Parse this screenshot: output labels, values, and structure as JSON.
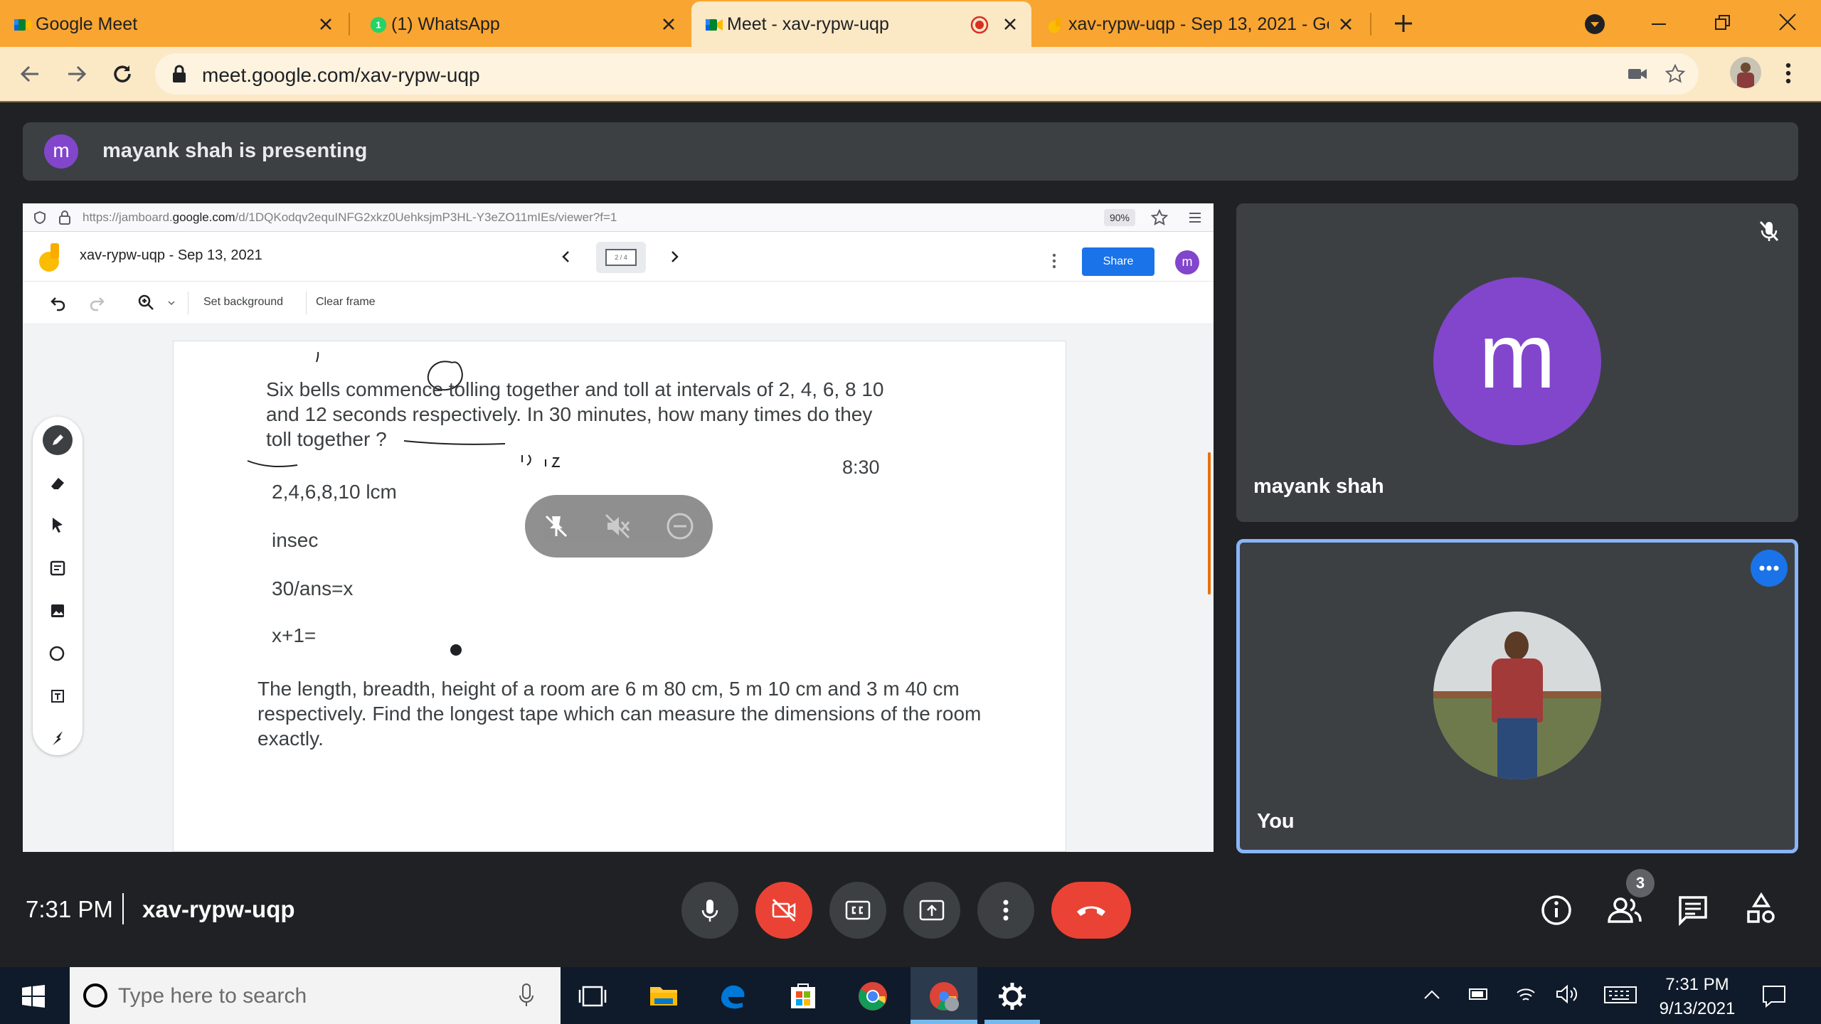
{
  "browser": {
    "tabs": [
      {
        "title": "Google Meet"
      },
      {
        "title": "(1) WhatsApp",
        "badge": "1"
      },
      {
        "title": "Meet - xav-rypw-uqp"
      },
      {
        "title": "xav-rypw-uqp - Sep 13, 2021 - Go"
      }
    ],
    "url": "meet.google.com/xav-rypw-uqp",
    "accent_color": "#f9a531"
  },
  "meet": {
    "presenting_banner": {
      "avatar_letter": "m",
      "text": "mayank shah is presenting"
    },
    "presentation": {
      "firefox_url_prefix": "https://jamboard.",
      "firefox_url_domain": "google.com",
      "firefox_url_rest": "/d/1DQKodqv2equINFG2xkz0UehksjmP3HL-Y3eZO11mIEs/viewer?f=1",
      "zoom": "90%",
      "jamboard_title": "xav-rypw-uqp - Sep 13, 2021",
      "frame_indicator": "2 / 4",
      "share_label": "Share",
      "user_avatar_letter": "m",
      "set_background_label": "Set background",
      "clear_frame_label": "Clear frame",
      "frame_text": {
        "question1_line1": "Six bells commence tolling together and toll at intervals of 2, 4, 6, 8 10",
        "question1_line2": "and 12 seconds respectively. In 30 minutes, how many times do they",
        "question1_line3": "toll together ?",
        "note1": "2,4,6,8,10  lcm",
        "note2": "insec",
        "note3": "30/ans=x",
        "note4": "x+1=",
        "handwritten_time": "8:30",
        "question2_line1": "The length, breadth, height of a room are 6 m 80 cm, 5 m 10 cm and 3 m 40 cm",
        "question2_line2": "respectively. Find the longest tape which can measure the dimensions of the room",
        "question2_line3": "exactly."
      }
    },
    "participants": [
      {
        "name": "mayank shah",
        "avatar_letter": "m",
        "avatar_color": "#8146cc",
        "muted": true
      },
      {
        "name": "You"
      }
    ],
    "participant_count": "3",
    "time": "7:31 PM",
    "meeting_code": "xav-rypw-uqp"
  },
  "taskbar": {
    "search_placeholder": "Type here to search",
    "clock_time": "7:31 PM",
    "clock_date": "9/13/2021"
  }
}
